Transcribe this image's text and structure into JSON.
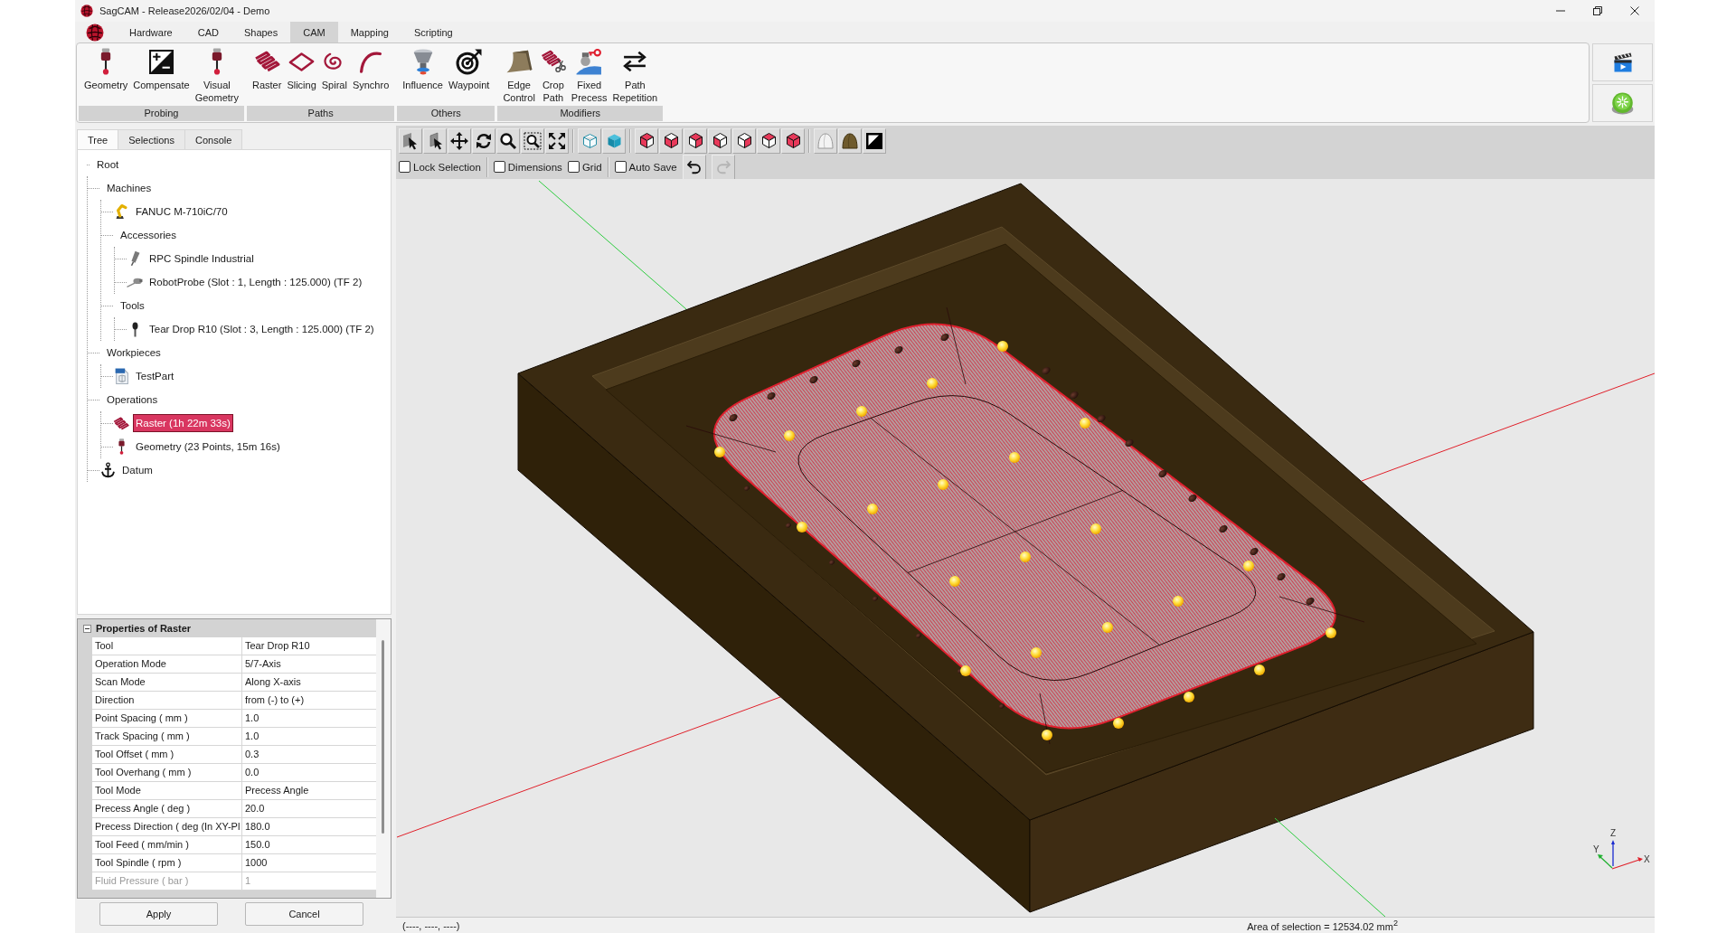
{
  "window": {
    "title": "SagCAM - Release2026/02/04 - Demo"
  },
  "menu_tabs": [
    {
      "label": "Hardware",
      "selected": false
    },
    {
      "label": "CAD",
      "selected": false
    },
    {
      "label": "Shapes",
      "selected": false
    },
    {
      "label": "CAM",
      "selected": true
    },
    {
      "label": "Mapping",
      "selected": false
    },
    {
      "label": "Scripting",
      "selected": false
    }
  ],
  "ribbon_groups": [
    {
      "label": "Probing",
      "buttons": [
        {
          "label": "Geometry",
          "kind": "stylus"
        },
        {
          "label": "Compensate",
          "kind": "compensate"
        },
        {
          "label": "Visual\nGeometry",
          "kind": "stylus"
        }
      ]
    },
    {
      "label": "Paths",
      "buttons": [
        {
          "label": "Raster",
          "kind": "raster"
        },
        {
          "label": "Slicing",
          "kind": "slicing"
        },
        {
          "label": "Spiral",
          "kind": "spiral"
        },
        {
          "label": "Synchro",
          "kind": "synchro"
        }
      ]
    },
    {
      "label": "Others",
      "buttons": [
        {
          "label": "Influence",
          "kind": "influence"
        },
        {
          "label": "Waypoint",
          "kind": "waypoint"
        }
      ]
    },
    {
      "label": "Modifiers",
      "buttons": [
        {
          "label": "Edge\nControl",
          "kind": "edge"
        },
        {
          "label": "Crop\nPath",
          "kind": "crop"
        },
        {
          "label": "Fixed\nPrecess",
          "kind": "precess"
        },
        {
          "label": "Path\nRepetition",
          "kind": "repeat"
        }
      ]
    }
  ],
  "panel_tabs": [
    {
      "label": "Tree",
      "selected": true
    },
    {
      "label": "Selections",
      "selected": false
    },
    {
      "label": "Console",
      "selected": false
    }
  ],
  "tree": [
    {
      "label": "Root",
      "kind": "group",
      "selected": false,
      "children": [
        {
          "label": "Machines",
          "kind": "group",
          "selected": false,
          "children": [
            {
              "label": "FANUC M-710iC/70",
              "kind": "machine",
              "selected": false
            },
            {
              "label": "Accessories",
              "kind": "group",
              "selected": false,
              "children": [
                {
                  "label": "RPC Spindle Industrial",
                  "kind": "spindle",
                  "selected": false
                },
                {
                  "label": "RobotProbe (Slot : 1, Length : 125.000) (TF 2)",
                  "kind": "probe",
                  "selected": false
                }
              ]
            },
            {
              "label": "Tools",
              "kind": "group",
              "selected": false,
              "children": [
                {
                  "label": "Tear Drop R10 (Slot : 3, Length : 125.000) (TF 2)",
                  "kind": "tool",
                  "selected": false
                }
              ]
            }
          ]
        },
        {
          "label": "Workpieces",
          "kind": "group",
          "selected": false,
          "children": [
            {
              "label": "TestPart",
              "kind": "workpiece",
              "selected": false
            }
          ]
        },
        {
          "label": "Operations",
          "kind": "group",
          "selected": false,
          "children": [
            {
              "label": "Raster (1h 22m 33s)",
              "kind": "raster",
              "selected": true
            },
            {
              "label": "Geometry (23 Points, 15m 16s)",
              "kind": "probing",
              "selected": false
            }
          ]
        },
        {
          "label": "Datum",
          "kind": "datum",
          "selected": false
        }
      ]
    }
  ],
  "properties": {
    "title": "Properties of Raster",
    "expanded": true,
    "rows": [
      {
        "name": "Tool",
        "value": "Tear Drop R10",
        "disabled": false
      },
      {
        "name": "Operation Mode",
        "value": "5/7-Axis",
        "disabled": false
      },
      {
        "name": "Scan Mode",
        "value": "Along X-axis",
        "disabled": false
      },
      {
        "name": "Direction",
        "value": "from (-) to (+)",
        "disabled": false
      },
      {
        "name": "Point Spacing ( mm )",
        "value": "1.0",
        "disabled": false
      },
      {
        "name": "Track Spacing ( mm )",
        "value": "1.0",
        "disabled": false
      },
      {
        "name": "Tool Offset ( mm )",
        "value": "0.3",
        "disabled": false
      },
      {
        "name": "Tool Overhang ( mm )",
        "value": "0.0",
        "disabled": false
      },
      {
        "name": "Tool Mode",
        "value": "Precess Angle",
        "disabled": false
      },
      {
        "name": "Precess Angle ( deg )",
        "value": "20.0",
        "disabled": false
      },
      {
        "name": "Precess Direction ( deg (In XY-Pl",
        "value": "180.0",
        "disabled": false
      },
      {
        "name": "Tool Feed ( mm/min )",
        "value": "150.0",
        "disabled": false
      },
      {
        "name": "Tool Spindle ( rpm )",
        "value": "1000",
        "disabled": false
      },
      {
        "name": "Fluid Pressure ( bar )",
        "value": "1",
        "disabled": true
      }
    ]
  },
  "dialog_buttons": [
    {
      "label": "Apply"
    },
    {
      "label": "Cancel"
    }
  ],
  "view_option_groups": [
    {
      "options": [
        {
          "label": "Lock Selection",
          "checked": false
        }
      ]
    },
    {
      "options": [
        {
          "label": "Dimensions",
          "checked": false
        },
        {
          "label": "Grid",
          "checked": false
        }
      ]
    },
    {
      "options": [
        {
          "label": "Auto Save",
          "checked": false
        }
      ]
    }
  ],
  "history_buttons": [
    {
      "kind": "undo",
      "disabled": false
    },
    {
      "kind": "redo",
      "disabled": true
    }
  ],
  "axis_labels": {
    "x": "X",
    "y": "Y",
    "z": "Z"
  },
  "status_bar": {
    "coordinates": "(----, ----, ----)",
    "selection_area": "Area of selection = 12534.02 mm$^{2}$"
  }
}
